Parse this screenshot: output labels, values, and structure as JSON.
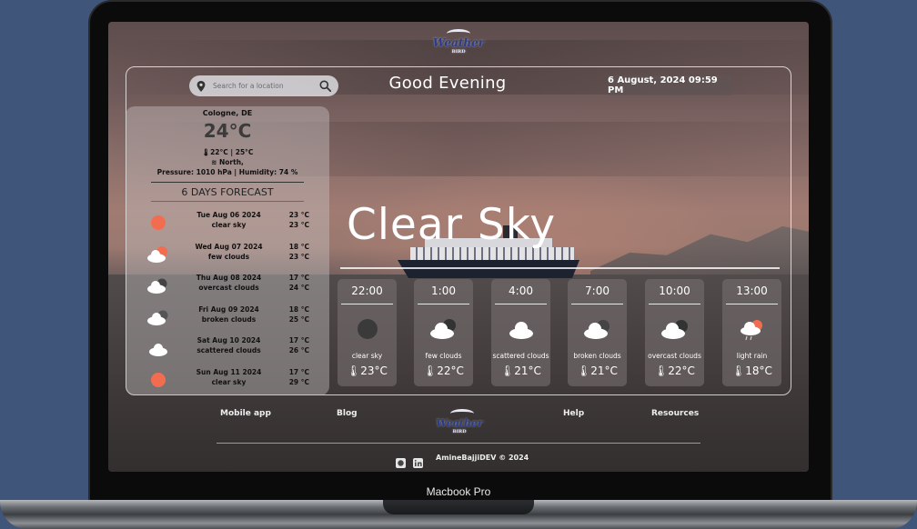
{
  "device": {
    "model": "Macbook Pro"
  },
  "app": {
    "greeting": "Good Evening",
    "datetime": "6 August, 2024  09:59 PM",
    "search": {
      "placeholder": "Search for a location"
    }
  },
  "current": {
    "city": "Cologne, DE",
    "temp": "24°C",
    "minmax": "22°C | 25°C",
    "wind": "North,",
    "pressure_humidity": "Pressure: 1010 hPa | Humidity: 74 %",
    "description": "Clear Sky"
  },
  "forecast": {
    "title": "6 DAYS FORECAST",
    "days": [
      {
        "date": "Tue Aug 06 2024",
        "desc": "clear sky",
        "min": "23 °C",
        "max": "23 °C",
        "icon": "sun-icon"
      },
      {
        "date": "Wed Aug 07 2024",
        "desc": "few clouds",
        "min": "18 °C",
        "max": "23 °C",
        "icon": "partly-cloudy-icon"
      },
      {
        "date": "Thu Aug 08 2024",
        "desc": "overcast clouds",
        "min": "17 °C",
        "max": "24 °C",
        "icon": "overcast-icon"
      },
      {
        "date": "Fri Aug 09 2024",
        "desc": "broken clouds",
        "min": "18 °C",
        "max": "25 °C",
        "icon": "broken-clouds-icon"
      },
      {
        "date": "Sat Aug 10 2024",
        "desc": "scattered clouds",
        "min": "17 °C",
        "max": "26 °C",
        "icon": "cloud-icon"
      },
      {
        "date": "Sun Aug 11 2024",
        "desc": "clear sky",
        "min": "17 °C",
        "max": "29 °C",
        "icon": "sun-icon"
      }
    ]
  },
  "hourly": [
    {
      "time": "22:00",
      "desc": "clear sky",
      "temp": "23°C",
      "icon": "moon-icon"
    },
    {
      "time": "1:00",
      "desc": "few clouds",
      "temp": "22°C",
      "icon": "cloudy-night-icon"
    },
    {
      "time": "4:00",
      "desc": "scattered clouds",
      "temp": "21°C",
      "icon": "cloud-icon"
    },
    {
      "time": "7:00",
      "desc": "broken clouds",
      "temp": "21°C",
      "icon": "broken-clouds-icon"
    },
    {
      "time": "10:00",
      "desc": "overcast clouds",
      "temp": "22°C",
      "icon": "overcast-icon"
    },
    {
      "time": "13:00",
      "desc": "light rain",
      "temp": "18°C",
      "icon": "rain-icon"
    }
  ],
  "footer": {
    "links": [
      "Mobile app",
      "Blog",
      "Help",
      "Resources"
    ],
    "copyright": "AmineBajjiDEV © 2024"
  },
  "colors": {
    "sun": "#f26d4f",
    "brand": "#2b3b8c"
  }
}
